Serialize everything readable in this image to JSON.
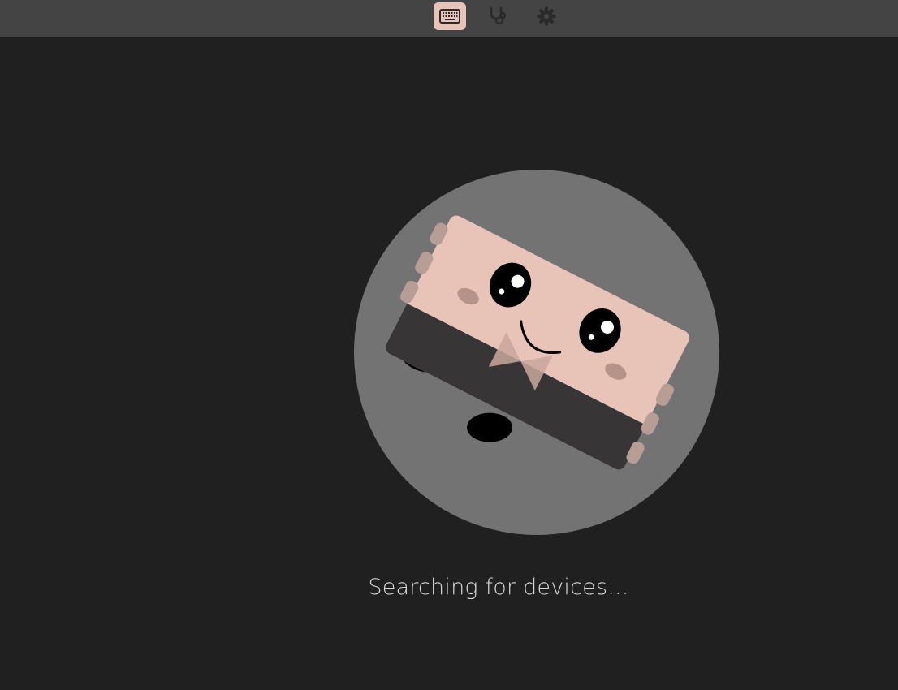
{
  "nav": {
    "tabs": [
      {
        "id": "configure",
        "icon": "keyboard-icon",
        "active": true
      },
      {
        "id": "test",
        "icon": "stethoscope-icon",
        "active": false
      },
      {
        "id": "settings",
        "icon": "gear-icon",
        "active": false
      }
    ]
  },
  "loader": {
    "status_text": "Searching for devices..."
  },
  "colors": {
    "background": "#202020",
    "topbar": "#444444",
    "accent": "#e8c4b8",
    "circle": "#737373",
    "icon_inactive": "#2a2a2a"
  }
}
